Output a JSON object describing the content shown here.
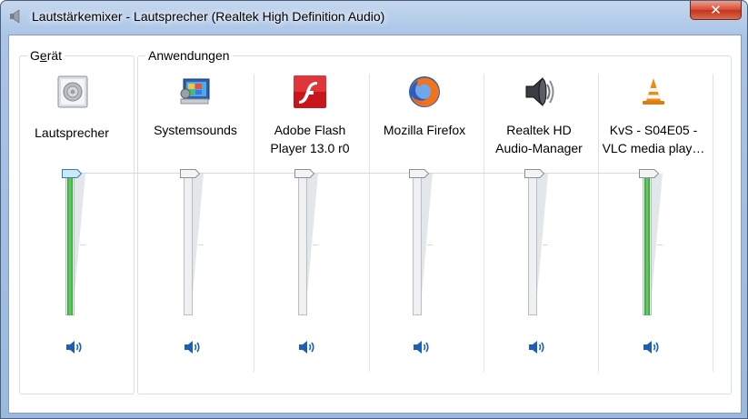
{
  "window": {
    "title": "Lautstärkemixer - Lautsprecher (Realtek High Definition Audio)",
    "close_glyph": "✕"
  },
  "device_group": {
    "label_prefix": "G",
    "label_underlined": "e",
    "label_suffix": "rät",
    "device": {
      "name": "Lautsprecher",
      "icon": "speaker-device-icon",
      "level_fraction": 1.0,
      "muted": false
    }
  },
  "apps_group": {
    "label": "Anwendungen",
    "apps": [
      {
        "line1": "Systemsounds",
        "line2": "",
        "icon": "system-sounds-icon",
        "level_fraction": 1.0,
        "muted": false
      },
      {
        "line1": "Adobe Flash",
        "line2": "Player 13.0 r0",
        "icon": "flash-player-icon",
        "level_fraction": 1.0,
        "muted": false
      },
      {
        "line1": "Mozilla Firefox",
        "line2": "",
        "icon": "firefox-icon",
        "level_fraction": 1.0,
        "muted": false
      },
      {
        "line1": "Realtek HD",
        "line2": "Audio-Manager",
        "icon": "realtek-speaker-icon",
        "level_fraction": 1.0,
        "muted": false
      },
      {
        "line1": "KvS - S04E05 -",
        "line2": "VLC media play…",
        "icon": "vlc-cone-icon",
        "level_fraction": 1.0,
        "muted": false
      }
    ]
  },
  "colors": {
    "level_green": "#3fbf3f",
    "accent_blue": "#1d5fb0",
    "frame_blue": "#a9c4e6"
  }
}
